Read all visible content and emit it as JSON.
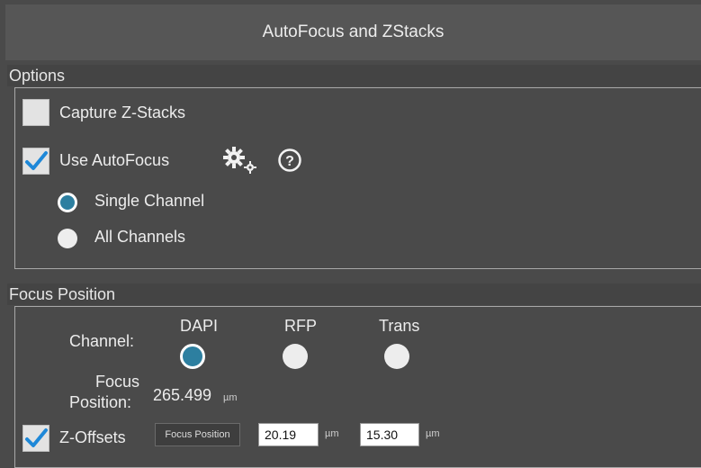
{
  "window": {
    "title": "AutoFocus and ZStacks"
  },
  "options": {
    "header": "Options",
    "capture_zstacks": {
      "label": "Capture Z-Stacks",
      "checked": false
    },
    "use_autofocus": {
      "label": "Use AutoFocus",
      "checked": true
    },
    "icons": [
      "gears-icon",
      "help-icon"
    ],
    "help_symbol": "?",
    "channel_mode": {
      "options": [
        "Single Channel",
        "All Channels"
      ],
      "selected": "Single Channel"
    }
  },
  "focus_position": {
    "header": "Focus Position",
    "channel_label": "Channel:",
    "channels": [
      "DAPI",
      "RFP",
      "Trans"
    ],
    "selected_channel": "DAPI",
    "focus_label_line1": "Focus",
    "focus_label_line2": "Position:",
    "focus_value": "265.499",
    "focus_unit": "µm",
    "zoffsets": {
      "label": "Z-Offsets",
      "checked": true,
      "reference_button": "Focus Position",
      "value1": "20.19",
      "unit1": "µm",
      "value2": "15.30",
      "unit2": "µm"
    }
  },
  "colors": {
    "accent": "#2d7fa0",
    "check": "#1e88d8",
    "background": "#4a4a4a"
  }
}
